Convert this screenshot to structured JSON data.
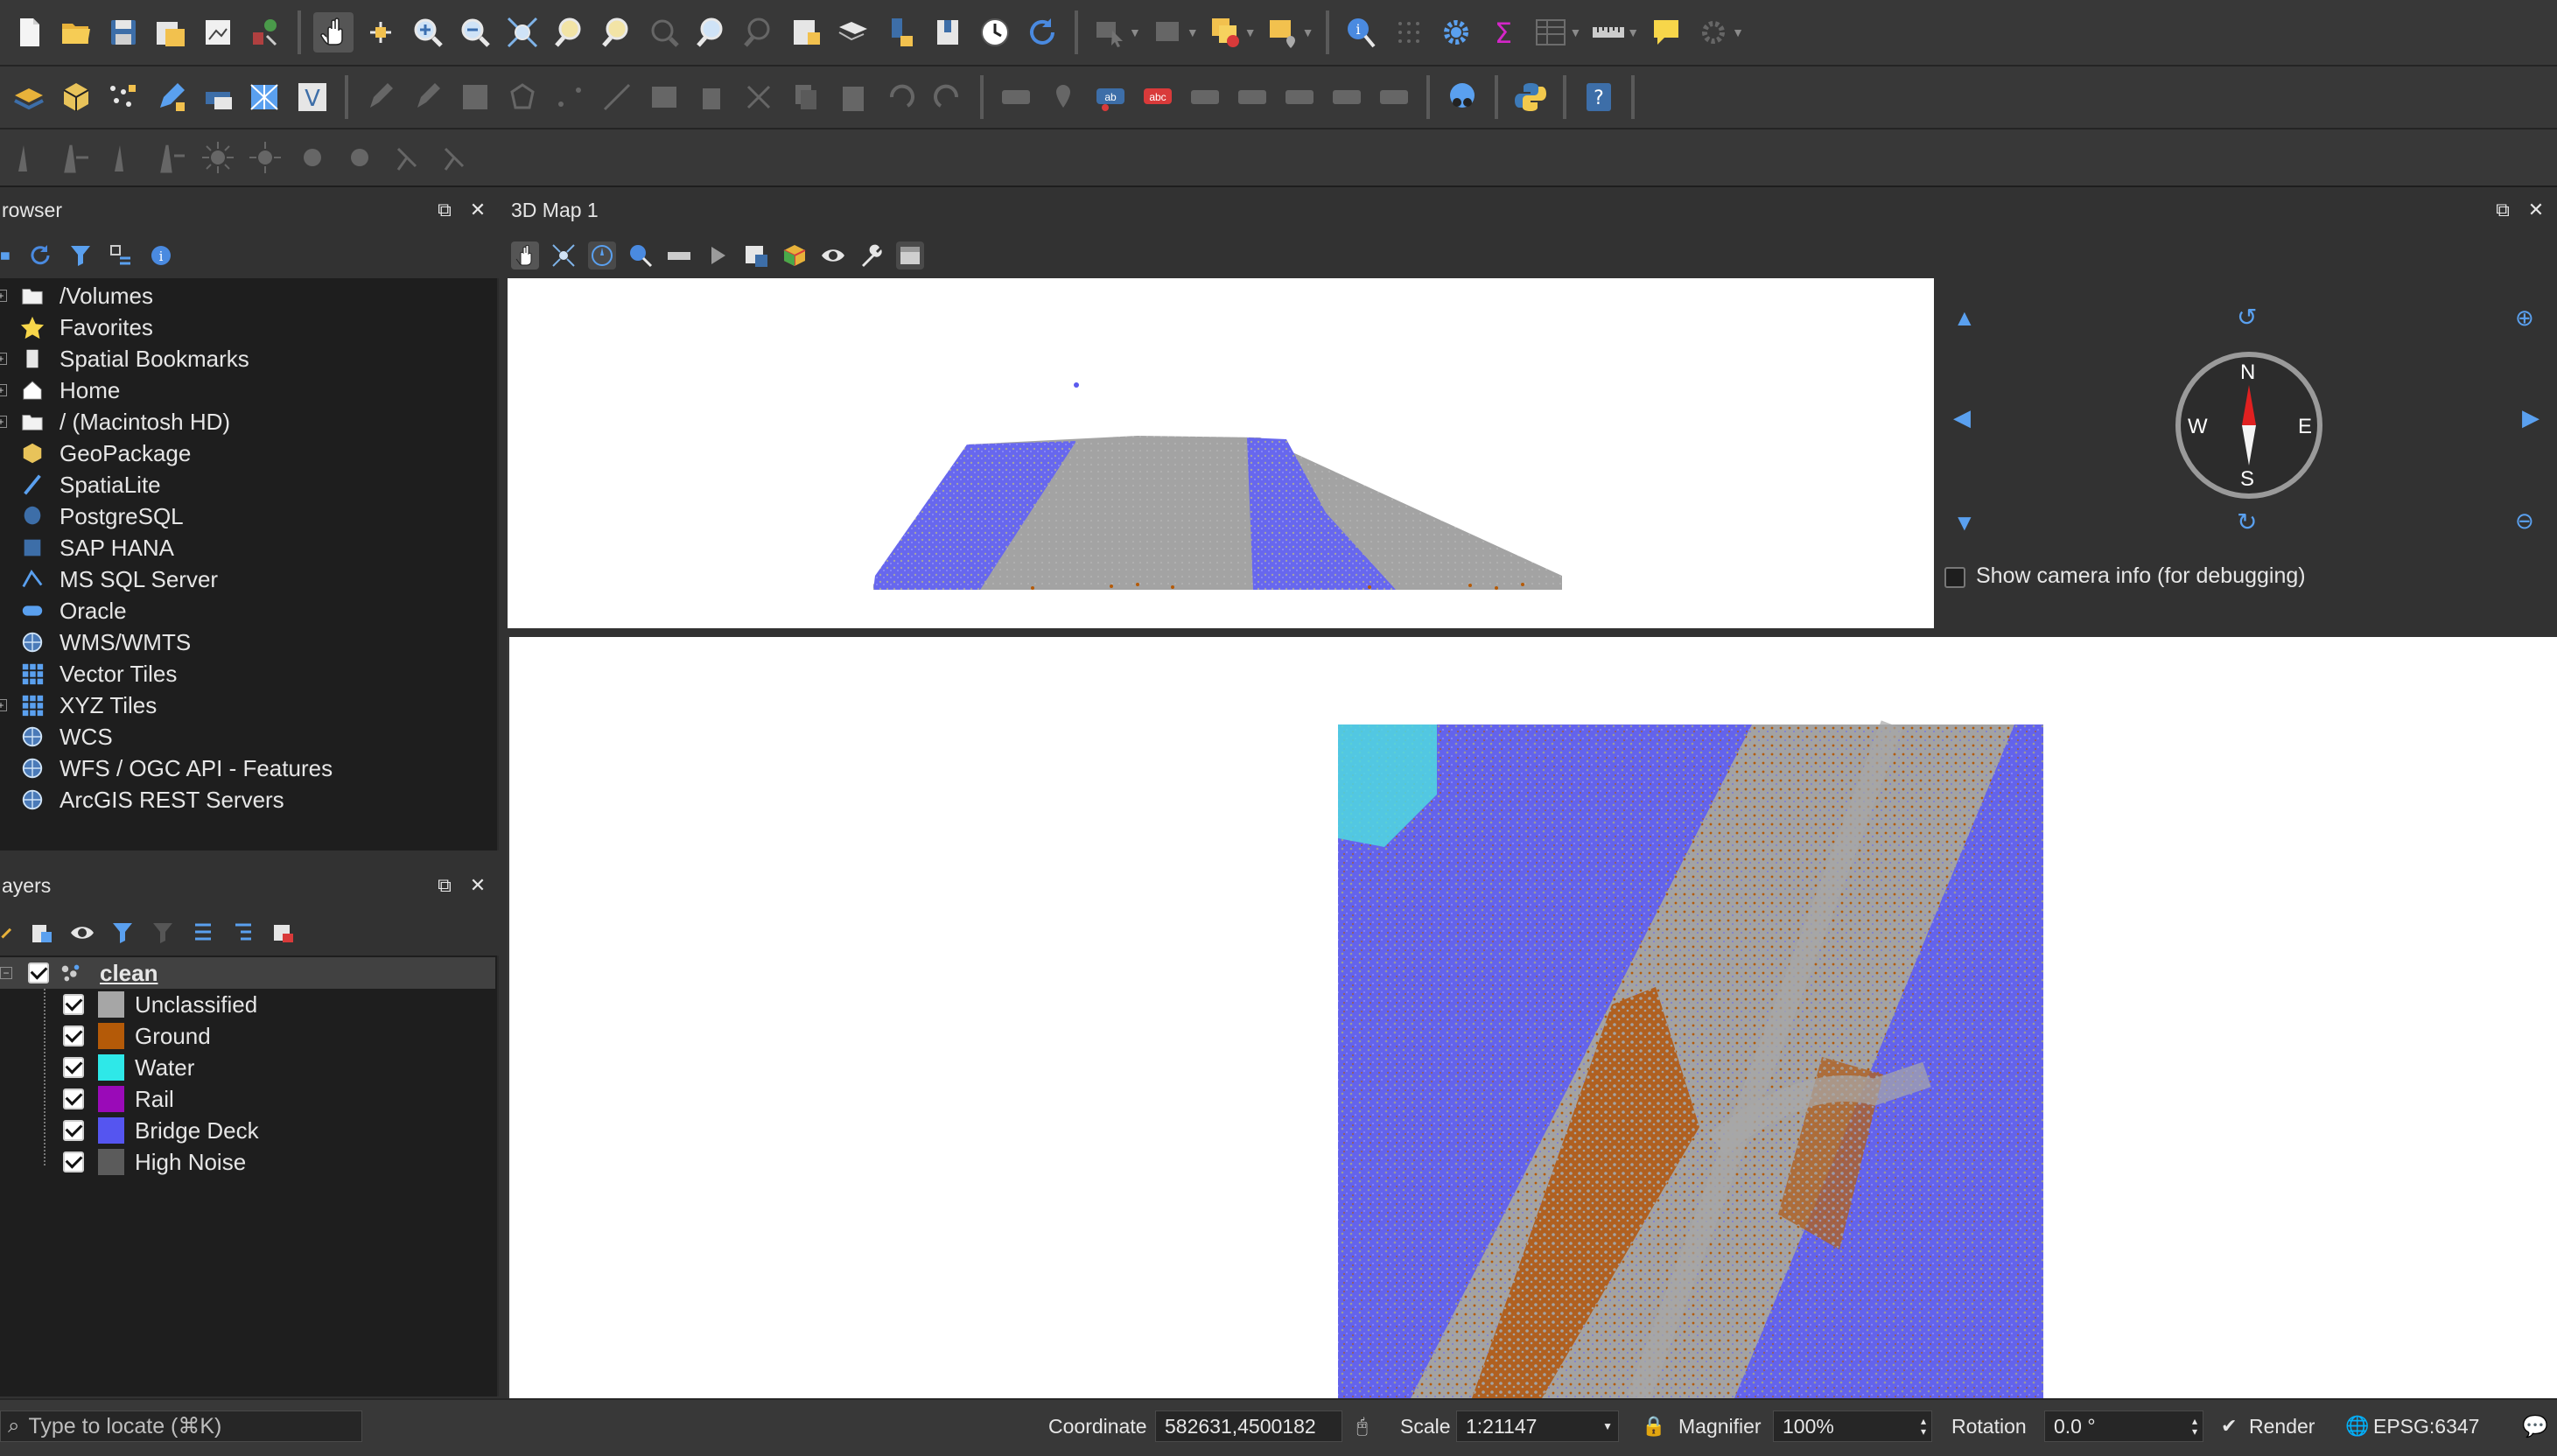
{
  "toolbar1": {
    "icons": [
      "new-project",
      "open-project",
      "save-project",
      "save-as",
      "print-layout",
      "style-manager",
      "pan-tool",
      "pan-to-selection",
      "zoom-in",
      "zoom-out",
      "zoom-full",
      "zoom-layer",
      "zoom-selection",
      "zoom-native",
      "zoom-last",
      "zoom-next",
      "new-bookmark",
      "show-bookmarks",
      "refresh",
      "temporal",
      "select-feature",
      "deselect",
      "identify",
      "attribute-table",
      "statistics",
      "measure",
      "annotation",
      "settings"
    ]
  },
  "toolbar2": {
    "icons": [
      "data-source-manager",
      "new-geopackage",
      "digitize",
      "edit-pencil",
      "add-layer"
    ]
  },
  "browser": {
    "title": "rowser",
    "items": [
      {
        "label": "/Volumes",
        "icon": "folder-icon",
        "expand": true
      },
      {
        "label": "Favorites",
        "icon": "star-icon",
        "expand": false
      },
      {
        "label": "Spatial Bookmarks",
        "icon": "bookmark-icon",
        "expand": true
      },
      {
        "label": "Home",
        "icon": "home-icon",
        "expand": true
      },
      {
        "label": "/ (Macintosh HD)",
        "icon": "folder-icon",
        "expand": true
      },
      {
        "label": "GeoPackage",
        "icon": "geopackage-icon",
        "expand": false
      },
      {
        "label": "SpatiaLite",
        "icon": "spatialite-icon",
        "expand": false
      },
      {
        "label": "PostgreSQL",
        "icon": "postgresql-icon",
        "expand": false
      },
      {
        "label": "SAP HANA",
        "icon": "sap-hana-icon",
        "expand": false
      },
      {
        "label": "MS SQL Server",
        "icon": "mssql-icon",
        "expand": false
      },
      {
        "label": "Oracle",
        "icon": "oracle-icon",
        "expand": false
      },
      {
        "label": "WMS/WMTS",
        "icon": "wms-icon",
        "expand": false
      },
      {
        "label": "Vector Tiles",
        "icon": "vector-tiles-icon",
        "expand": false
      },
      {
        "label": "XYZ Tiles",
        "icon": "xyz-tiles-icon",
        "expand": true
      },
      {
        "label": "WCS",
        "icon": "wcs-icon",
        "expand": false
      },
      {
        "label": "WFS / OGC API - Features",
        "icon": "wfs-icon",
        "expand": false
      },
      {
        "label": "ArcGIS REST Servers",
        "icon": "arcgis-icon",
        "expand": false
      }
    ]
  },
  "layers": {
    "title": "ayers",
    "layer_name": "clean",
    "classes": [
      {
        "label": "Unclassified",
        "color": "#a6a6a6"
      },
      {
        "label": "Ground",
        "color": "#b45a08"
      },
      {
        "label": "Water",
        "color": "#2ee8e8"
      },
      {
        "label": "Rail",
        "color": "#9a0ab8"
      },
      {
        "label": "Bridge Deck",
        "color": "#5555f0"
      },
      {
        "label": "High Noise",
        "color": "#5b5b5b"
      }
    ]
  },
  "map3d": {
    "title": "3D Map 1",
    "compass": {
      "n": "N",
      "s": "S",
      "e": "E",
      "w": "W"
    },
    "camera_info_label": "Show camera info (for debugging)"
  },
  "status": {
    "locate_placeholder": "Type to locate (⌘K)",
    "coordinate_label": "Coordinate",
    "coordinate_value": "582631,4500182",
    "scale_label": "Scale",
    "scale_value": "1:21147",
    "magnifier_label": "Magnifier",
    "magnifier_value": "100%",
    "rotation_label": "Rotation",
    "rotation_value": "0.0 °",
    "render_label": "Render",
    "crs_label": "EPSG:6347"
  }
}
